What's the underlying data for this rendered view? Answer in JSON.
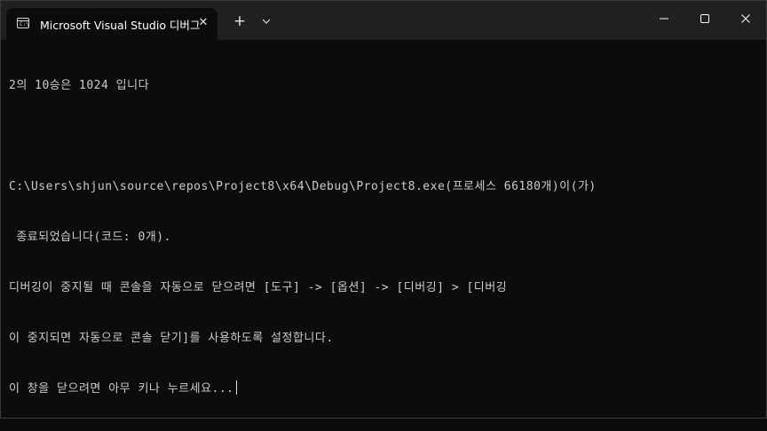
{
  "window": {
    "tab_title": "Microsoft Visual Studio 디버그",
    "tab_icon_text": "C:\\",
    "new_tab_label": "+",
    "close_tab_label": "✕"
  },
  "console": {
    "lines": [
      "2의 10승은 1024 입니다",
      "",
      "C:\\Users\\shjun\\source\\repos\\Project8\\x64\\Debug\\Project8.exe(프로세스 66180개)이(가)",
      " 종료되었습니다(코드: 0개).",
      "디버깅이 중지될 때 콘솔을 자동으로 닫으려면 [도구] -> [옵션] -> [디버깅] > [디버깅",
      "이 중지되면 자동으로 콘솔 닫기]를 사용하도록 설정합니다.",
      "이 창을 닫으려면 아무 키나 누르세요..."
    ]
  }
}
